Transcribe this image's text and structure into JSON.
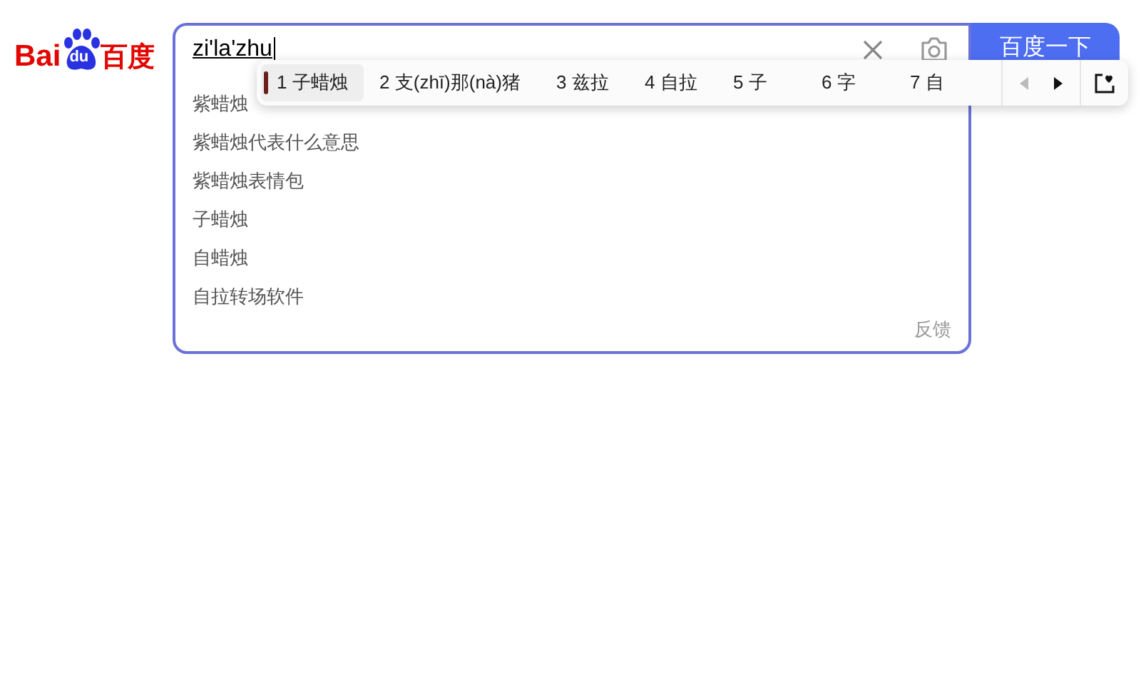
{
  "logo": {
    "parts": [
      "Bai",
      "du",
      "百度"
    ]
  },
  "search": {
    "value": "zi'la'zhu",
    "button": "百度一下"
  },
  "suggestions": [
    "紫蜡烛",
    "紫蜡烛代表什么意思",
    "紫蜡烛表情包",
    "子蜡烛",
    "自蜡烛",
    "自拉转场软件"
  ],
  "feedback": "反馈",
  "ime": {
    "candidates": [
      {
        "index": "1",
        "text": "子蜡烛",
        "selected": true
      },
      {
        "index": "2",
        "text": "支(zhī)那(nà)猪",
        "selected": false
      },
      {
        "index": "3",
        "text": "兹拉",
        "selected": false
      },
      {
        "index": "4",
        "text": "自拉",
        "selected": false
      },
      {
        "index": "5",
        "text": "子",
        "selected": false
      },
      {
        "index": "6",
        "text": "字",
        "selected": false
      },
      {
        "index": "7",
        "text": "自",
        "selected": false
      }
    ],
    "prev_disabled": true,
    "next_disabled": false
  }
}
